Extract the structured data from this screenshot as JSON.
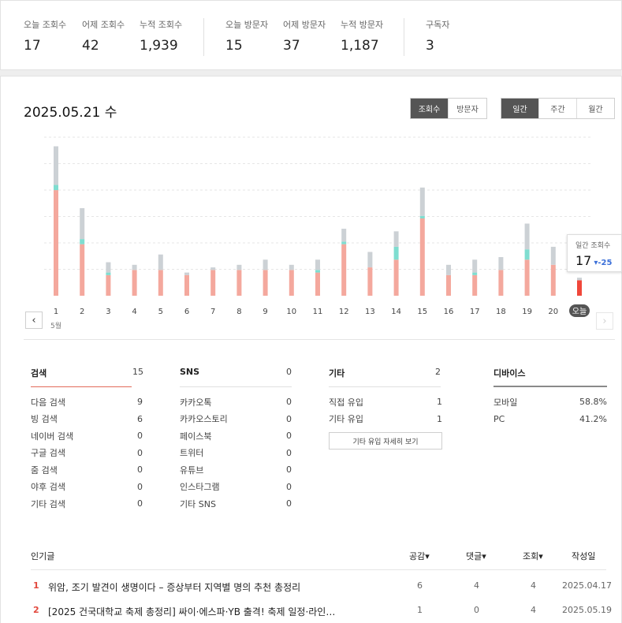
{
  "top_stats": [
    {
      "label": "오늘 조회수",
      "value": "17"
    },
    {
      "label": "어제 조회수",
      "value": "42"
    },
    {
      "label": "누적 조회수",
      "value": "1,939"
    },
    {
      "label": "오늘 방문자",
      "value": "15"
    },
    {
      "label": "어제 방문자",
      "value": "37"
    },
    {
      "label": "누적 방문자",
      "value": "1,187"
    },
    {
      "label": "구독자",
      "value": "3"
    }
  ],
  "main": {
    "date_title": "2025.05.21 수",
    "metric_tabs": [
      {
        "label": "조회수",
        "active": true
      },
      {
        "label": "방문자",
        "active": false
      }
    ],
    "period_tabs": [
      {
        "label": "일간",
        "active": true
      },
      {
        "label": "주간",
        "active": false
      },
      {
        "label": "월간",
        "active": false
      }
    ],
    "nav": {
      "prev": "‹",
      "next": "›"
    }
  },
  "chart_data": {
    "type": "bar",
    "stacked": true,
    "categories": [
      "1",
      "2",
      "3",
      "4",
      "5",
      "6",
      "7",
      "8",
      "9",
      "10",
      "11",
      "12",
      "13",
      "14",
      "15",
      "16",
      "17",
      "18",
      "19",
      "20",
      "오늘"
    ],
    "month_label": "5월",
    "colors": {
      "segment1": "#f4a89d",
      "segment2": "#7fddd0",
      "segment3": "#ccd1d5",
      "today": "#f0473a",
      "today_bg": "#555555"
    },
    "series": [
      {
        "values": [
          41,
          20,
          8,
          10,
          10,
          8,
          10,
          10,
          10,
          10,
          9,
          20,
          11,
          14,
          30,
          8,
          8,
          10,
          14,
          12,
          6
        ]
      },
      {
        "values": [
          2,
          2,
          1,
          0,
          0,
          0,
          0,
          0,
          0,
          0,
          1,
          1,
          0,
          5,
          1,
          0,
          1,
          0,
          4,
          0,
          0
        ]
      },
      {
        "values": [
          15,
          12,
          4,
          2,
          6,
          1,
          1,
          2,
          4,
          2,
          4,
          5,
          6,
          6,
          11,
          4,
          5,
          5,
          10,
          7,
          1
        ]
      }
    ],
    "ylim": [
      0,
      60
    ],
    "tooltip": {
      "label": "일간 조회수",
      "value": "17",
      "diff": "▾-25"
    }
  },
  "sources": {
    "search": {
      "title": "검색",
      "count": "15",
      "rows": [
        {
          "label": "다음 검색",
          "value": "9"
        },
        {
          "label": "빙 검색",
          "value": "6"
        },
        {
          "label": "네이버 검색",
          "value": "0"
        },
        {
          "label": "구글 검색",
          "value": "0"
        },
        {
          "label": "줌 검색",
          "value": "0"
        },
        {
          "label": "야후 검색",
          "value": "0"
        },
        {
          "label": "기타 검색",
          "value": "0"
        }
      ]
    },
    "sns": {
      "title": "SNS",
      "count": "0",
      "rows": [
        {
          "label": "카카오톡",
          "value": "0"
        },
        {
          "label": "카카오스토리",
          "value": "0"
        },
        {
          "label": "페이스북",
          "value": "0"
        },
        {
          "label": "트위터",
          "value": "0"
        },
        {
          "label": "유튜브",
          "value": "0"
        },
        {
          "label": "인스타그램",
          "value": "0"
        },
        {
          "label": "기타 SNS",
          "value": "0"
        }
      ]
    },
    "other": {
      "title": "기타",
      "count": "2",
      "rows": [
        {
          "label": "직접 유입",
          "value": "1"
        },
        {
          "label": "기타 유입",
          "value": "1"
        }
      ],
      "detail_button": "기타 유입 자세히 보기"
    },
    "device": {
      "title": "디바이스",
      "rows": [
        {
          "label": "모바일",
          "value": "58.8%"
        },
        {
          "label": "PC",
          "value": "41.2%"
        }
      ]
    }
  },
  "popular": {
    "title": "인기글",
    "columns": {
      "likes": "공감▾",
      "comments": "댓글▾",
      "views": "조회▾",
      "date": "작성일"
    },
    "rows": [
      {
        "rank": "1",
        "title": "위암, 조기 발견이 생명이다 – 증상부터 지역별 명의 추천 총정리",
        "likes": "6",
        "comments": "4",
        "views": "4",
        "date": "2025.04.17"
      },
      {
        "rank": "2",
        "title": "[2025 건국대학교 축제 총정리] 싸이·에스파·YB 출격! 축제 일정·라인…",
        "likes": "1",
        "comments": "0",
        "views": "4",
        "date": "2025.05.19"
      }
    ]
  }
}
